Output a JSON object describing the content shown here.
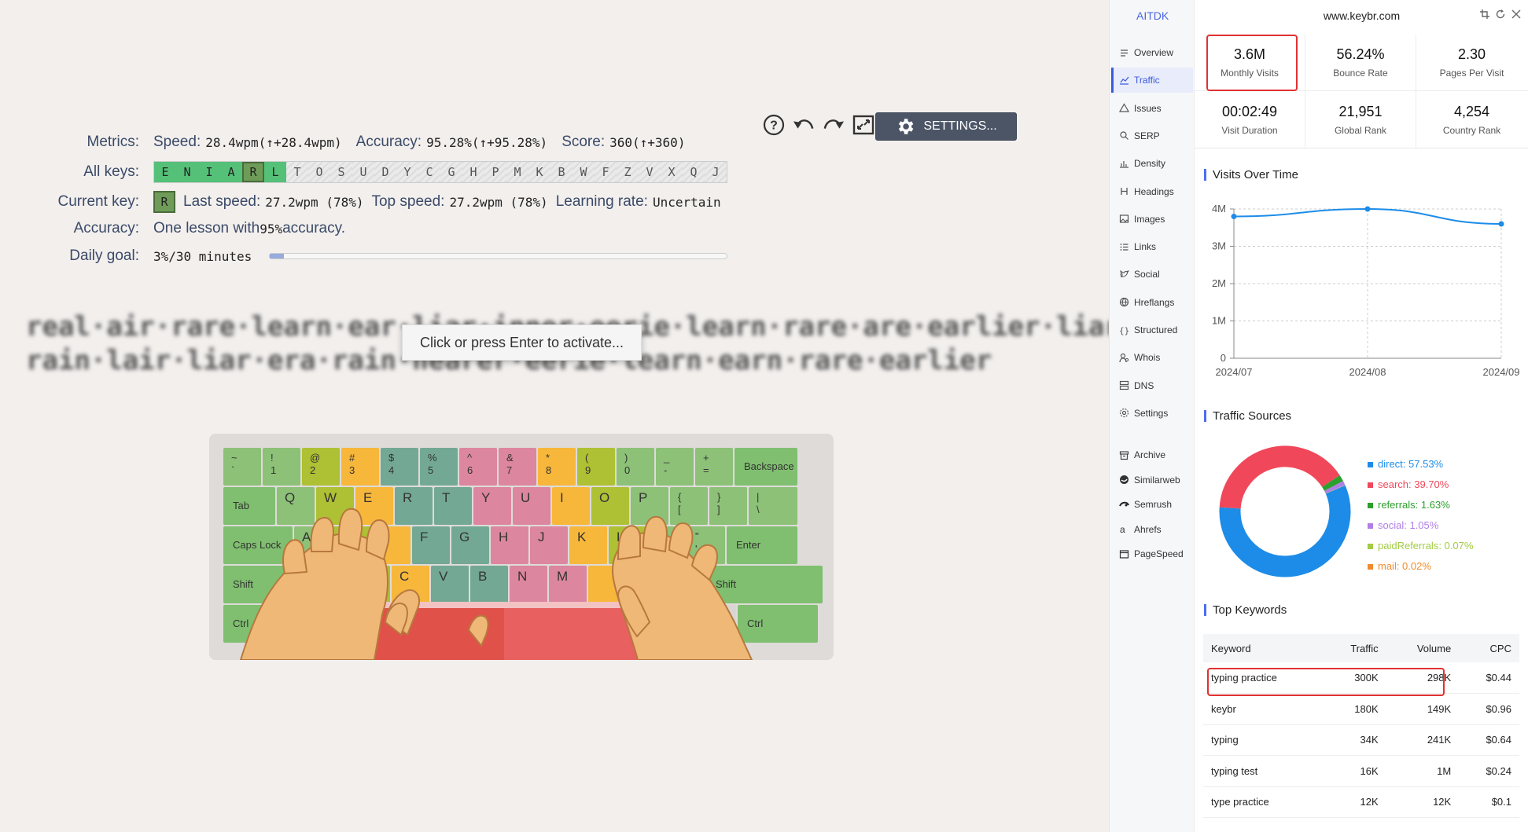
{
  "toolbar": {
    "settings_label": "SETTINGS..."
  },
  "metrics": {
    "label": "Metrics:",
    "speed_label": "Speed:",
    "speed": "28.4wpm",
    "speed_delta": "(↑+28.4wpm)",
    "accuracy_label": "Accuracy:",
    "accuracy": "95.28%",
    "accuracy_delta": "(↑+95.28%)",
    "score_label": "Score:",
    "score": "360",
    "score_delta": "(↑+360)"
  },
  "all_keys": {
    "label": "All keys:",
    "keys": [
      "E",
      "N",
      "I",
      "A",
      "R",
      "L",
      "T",
      "O",
      "S",
      "U",
      "D",
      "Y",
      "C",
      "G",
      "H",
      "P",
      "M",
      "K",
      "B",
      "W",
      "F",
      "Z",
      "V",
      "X",
      "Q",
      "J"
    ],
    "learned_count": 6,
    "current": "R"
  },
  "current_key": {
    "label": "Current key:",
    "key": "R",
    "last_speed_label": "Last speed:",
    "last_speed": "27.2wpm (78%)",
    "top_speed_label": "Top speed:",
    "top_speed": "27.2wpm (78%)",
    "learning_rate_label": "Learning rate:",
    "learning_rate": "Uncertain"
  },
  "accuracy_row": {
    "label": "Accuracy:",
    "text_pre": "One lesson with ",
    "value": "95%",
    "text_post": " accuracy."
  },
  "daily_goal": {
    "label": "Daily goal:",
    "value": "3%/30 minutes",
    "progress": 0.03
  },
  "lesson_text": {
    "line1": "real·air·rare·learn·ear·liar·inner·eerie·learn·rare·are·earlier·liar·",
    "line2": "rain·lair·liar·era·rain·nearer·eerie·learn·earn·rare·earlier"
  },
  "activate_prompt": "Click or press Enter to activate...",
  "keyboard": {
    "row1": [
      [
        "~\n`",
        "c-g"
      ],
      [
        "!\n1",
        "c-g"
      ],
      [
        "@\n2",
        "c-y"
      ],
      [
        "#\n3",
        "c-o"
      ],
      [
        "$\n4",
        "c-t"
      ],
      [
        "%\n5",
        "c-t"
      ],
      [
        "^\n6",
        "c-p"
      ],
      [
        "&\n7",
        "c-p"
      ],
      [
        "*\n8",
        "c-o"
      ],
      [
        "(\n9",
        "c-y"
      ],
      [
        ")\n0",
        "c-g"
      ],
      [
        "_\n-",
        "c-g"
      ],
      [
        "+\n=",
        "c-g"
      ]
    ],
    "backspace": "Backspace",
    "tab": "Tab",
    "row2": [
      [
        "Q",
        "c-g"
      ],
      [
        "W",
        "c-y"
      ],
      [
        "E",
        "c-o"
      ],
      [
        "R",
        "c-t"
      ],
      [
        "T",
        "c-t"
      ],
      [
        "Y",
        "c-p"
      ],
      [
        "U",
        "c-p"
      ],
      [
        "I",
        "c-o"
      ],
      [
        "O",
        "c-y"
      ],
      [
        "P",
        "c-g"
      ],
      [
        "{\n[",
        "c-g"
      ],
      [
        "}\n]",
        "c-g"
      ],
      [
        "|\n\\",
        "c-g"
      ]
    ],
    "caps": "Caps Lock",
    "row3": [
      [
        "A",
        "c-g"
      ],
      [
        "S",
        "c-y"
      ],
      [
        "D",
        "c-o"
      ],
      [
        "F",
        "c-t"
      ],
      [
        "G",
        "c-t"
      ],
      [
        "H",
        "c-p"
      ],
      [
        "J",
        "c-p"
      ],
      [
        "K",
        "c-o"
      ],
      [
        "L",
        "c-y"
      ],
      [
        ":\n;",
        "c-g"
      ],
      [
        "\"\n'",
        "c-g"
      ]
    ],
    "enter": "Enter",
    "shift_left": "Shift",
    "row4": [
      [
        "Z",
        "c-g"
      ],
      [
        "X",
        "c-y"
      ],
      [
        "C",
        "c-o"
      ],
      [
        "V",
        "c-t"
      ],
      [
        "B",
        "c-t"
      ],
      [
        "N",
        "c-p"
      ],
      [
        "M",
        "c-p"
      ]
    ],
    "shift_right": "Shift",
    "ctrl_left": "Ctrl",
    "ctrl_right": "Ctrl"
  },
  "aitdk": {
    "brand": "AITDK",
    "domain": "www.keybr.com",
    "nav": [
      "Overview",
      "Traffic",
      "Issues",
      "SERP",
      "Density",
      "Headings",
      "Images",
      "Links",
      "Social",
      "Hreflangs",
      "Structured",
      "Whois",
      "DNS",
      "Settings"
    ],
    "nav_active": "Traffic",
    "external": [
      "Archive",
      "Similarweb",
      "Semrush",
      "Ahrefs",
      "PageSpeed"
    ],
    "stats": [
      {
        "value": "3.6M",
        "label": "Monthly Visits"
      },
      {
        "value": "56.24%",
        "label": "Bounce Rate"
      },
      {
        "value": "2.30",
        "label": "Pages Per Visit"
      },
      {
        "value": "00:02:49",
        "label": "Visit Duration"
      },
      {
        "value": "21,951",
        "label": "Global Rank"
      },
      {
        "value": "4,254",
        "label": "Country Rank"
      }
    ],
    "visits_title": "Visits Over Time",
    "sources_title": "Traffic Sources",
    "keywords_title": "Top Keywords",
    "sources": [
      {
        "label": "direct: 57.53%",
        "value": 57.53,
        "color": "#1c8ce8"
      },
      {
        "label": "search: 39.70%",
        "value": 39.7,
        "color": "#f0485a"
      },
      {
        "label": "referrals: 1.63%",
        "value": 1.63,
        "color": "#2ca02c"
      },
      {
        "label": "social: 1.05%",
        "value": 1.05,
        "color": "#b07ee8"
      },
      {
        "label": "paidReferrals: 0.07%",
        "value": 0.07,
        "color": "#a3cc44"
      },
      {
        "label": "mail: 0.02%",
        "value": 0.02,
        "color": "#f08c2c"
      }
    ],
    "keywords_header": [
      "Keyword",
      "Traffic",
      "Volume",
      "CPC"
    ],
    "keywords": [
      [
        "typing practice",
        "300K",
        "298K",
        "$0.44"
      ],
      [
        "keybr",
        "180K",
        "149K",
        "$0.96"
      ],
      [
        "typing",
        "34K",
        "241K",
        "$0.64"
      ],
      [
        "typing test",
        "16K",
        "1M",
        "$0.24"
      ],
      [
        "type practice",
        "12K",
        "12K",
        "$0.1"
      ]
    ]
  },
  "chart_data": {
    "type": "line",
    "title": "Visits Over Time",
    "x": [
      "2024/07",
      "2024/08",
      "2024/09"
    ],
    "series": [
      {
        "values": [
          3.8,
          4.0,
          3.6
        ]
      }
    ],
    "yticks": [
      "0",
      "1M",
      "2M",
      "3M",
      "4M"
    ],
    "ylim": [
      0,
      4
    ],
    "unit": "M",
    "grid": true
  }
}
